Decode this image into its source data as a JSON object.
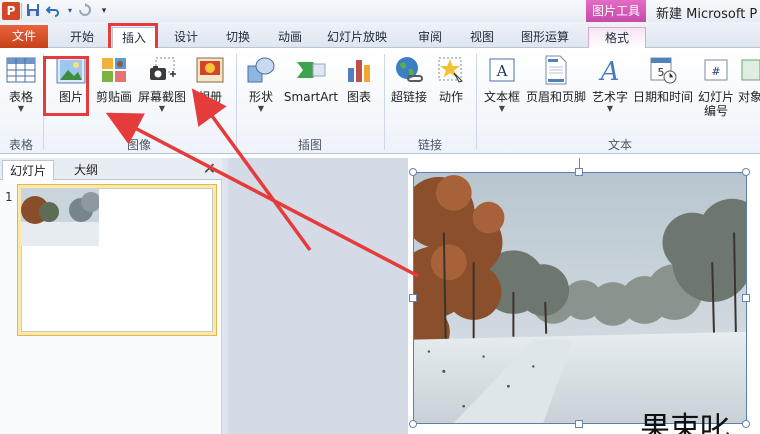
{
  "titlebar": {
    "app_letter": "P",
    "context_tools_label": "图片工具",
    "document_title": "新建 Microsoft P"
  },
  "tabs": {
    "file": "文件",
    "home": "开始",
    "insert": "插入",
    "design": "设计",
    "transitions": "切换",
    "animations": "动画",
    "slideshow": "幻灯片放映",
    "review": "审阅",
    "view": "视图",
    "shape_ops": "图形运算",
    "format": "格式"
  },
  "ribbon": {
    "groups": {
      "tables": "表格",
      "images": "图像",
      "illustrations": "插图",
      "links": "链接",
      "text": "文本"
    },
    "buttons": {
      "table": "表格",
      "picture": "图片",
      "clipart": "剪贴画",
      "screenshot": "屏幕截图",
      "album": "相册",
      "shapes": "形状",
      "smartart": "SmartArt",
      "chart": "图表",
      "hyperlink": "超链接",
      "action": "动作",
      "textbox": "文本框",
      "header_footer": "页眉和页脚",
      "wordart": "艺术字",
      "datetime": "日期和时间",
      "slide_number_1": "幻灯片",
      "slide_number_2": "编号",
      "object": "对象"
    },
    "dropdown_glyph": "▼"
  },
  "pane": {
    "tab_slides": "幻灯片",
    "tab_outline": "大纲",
    "close_glyph": "✕",
    "slide_number": "1"
  },
  "slide": {
    "partial_text": "果束叱"
  },
  "icons": {
    "save": "save-icon",
    "undo": "undo-icon",
    "redo": "redo-icon",
    "customize": "customize-qat-icon"
  },
  "colors": {
    "file_tab": "#d24726",
    "context_tab": "#c74aa9",
    "annotation_red": "#e53b3b"
  }
}
